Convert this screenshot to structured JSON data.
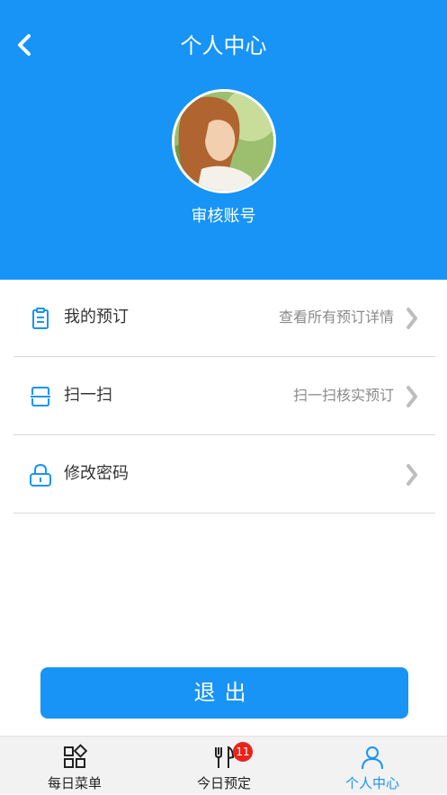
{
  "header": {
    "title": "个人中心",
    "username": "审核账号",
    "background_color": "#1794f6"
  },
  "menu": [
    {
      "label": "我的预订",
      "detail": "查看所有预订详情",
      "icon": "clipboard-icon"
    },
    {
      "label": "扫一扫",
      "detail": "扫一扫核实预订",
      "icon": "scan-icon"
    },
    {
      "label": "修改密码",
      "detail": "",
      "icon": "lock-icon"
    }
  ],
  "logout_label": "退出",
  "tabbar": {
    "tabs": [
      {
        "label": "每日菜单",
        "icon": "grid-icon",
        "active": false
      },
      {
        "label": "今日预定",
        "icon": "utensils-icon",
        "badge": "11",
        "active": false
      },
      {
        "label": "个人中心",
        "icon": "user-icon",
        "active": true
      }
    ],
    "active_color": "#1794f6",
    "badge_color": "#e8231b"
  }
}
